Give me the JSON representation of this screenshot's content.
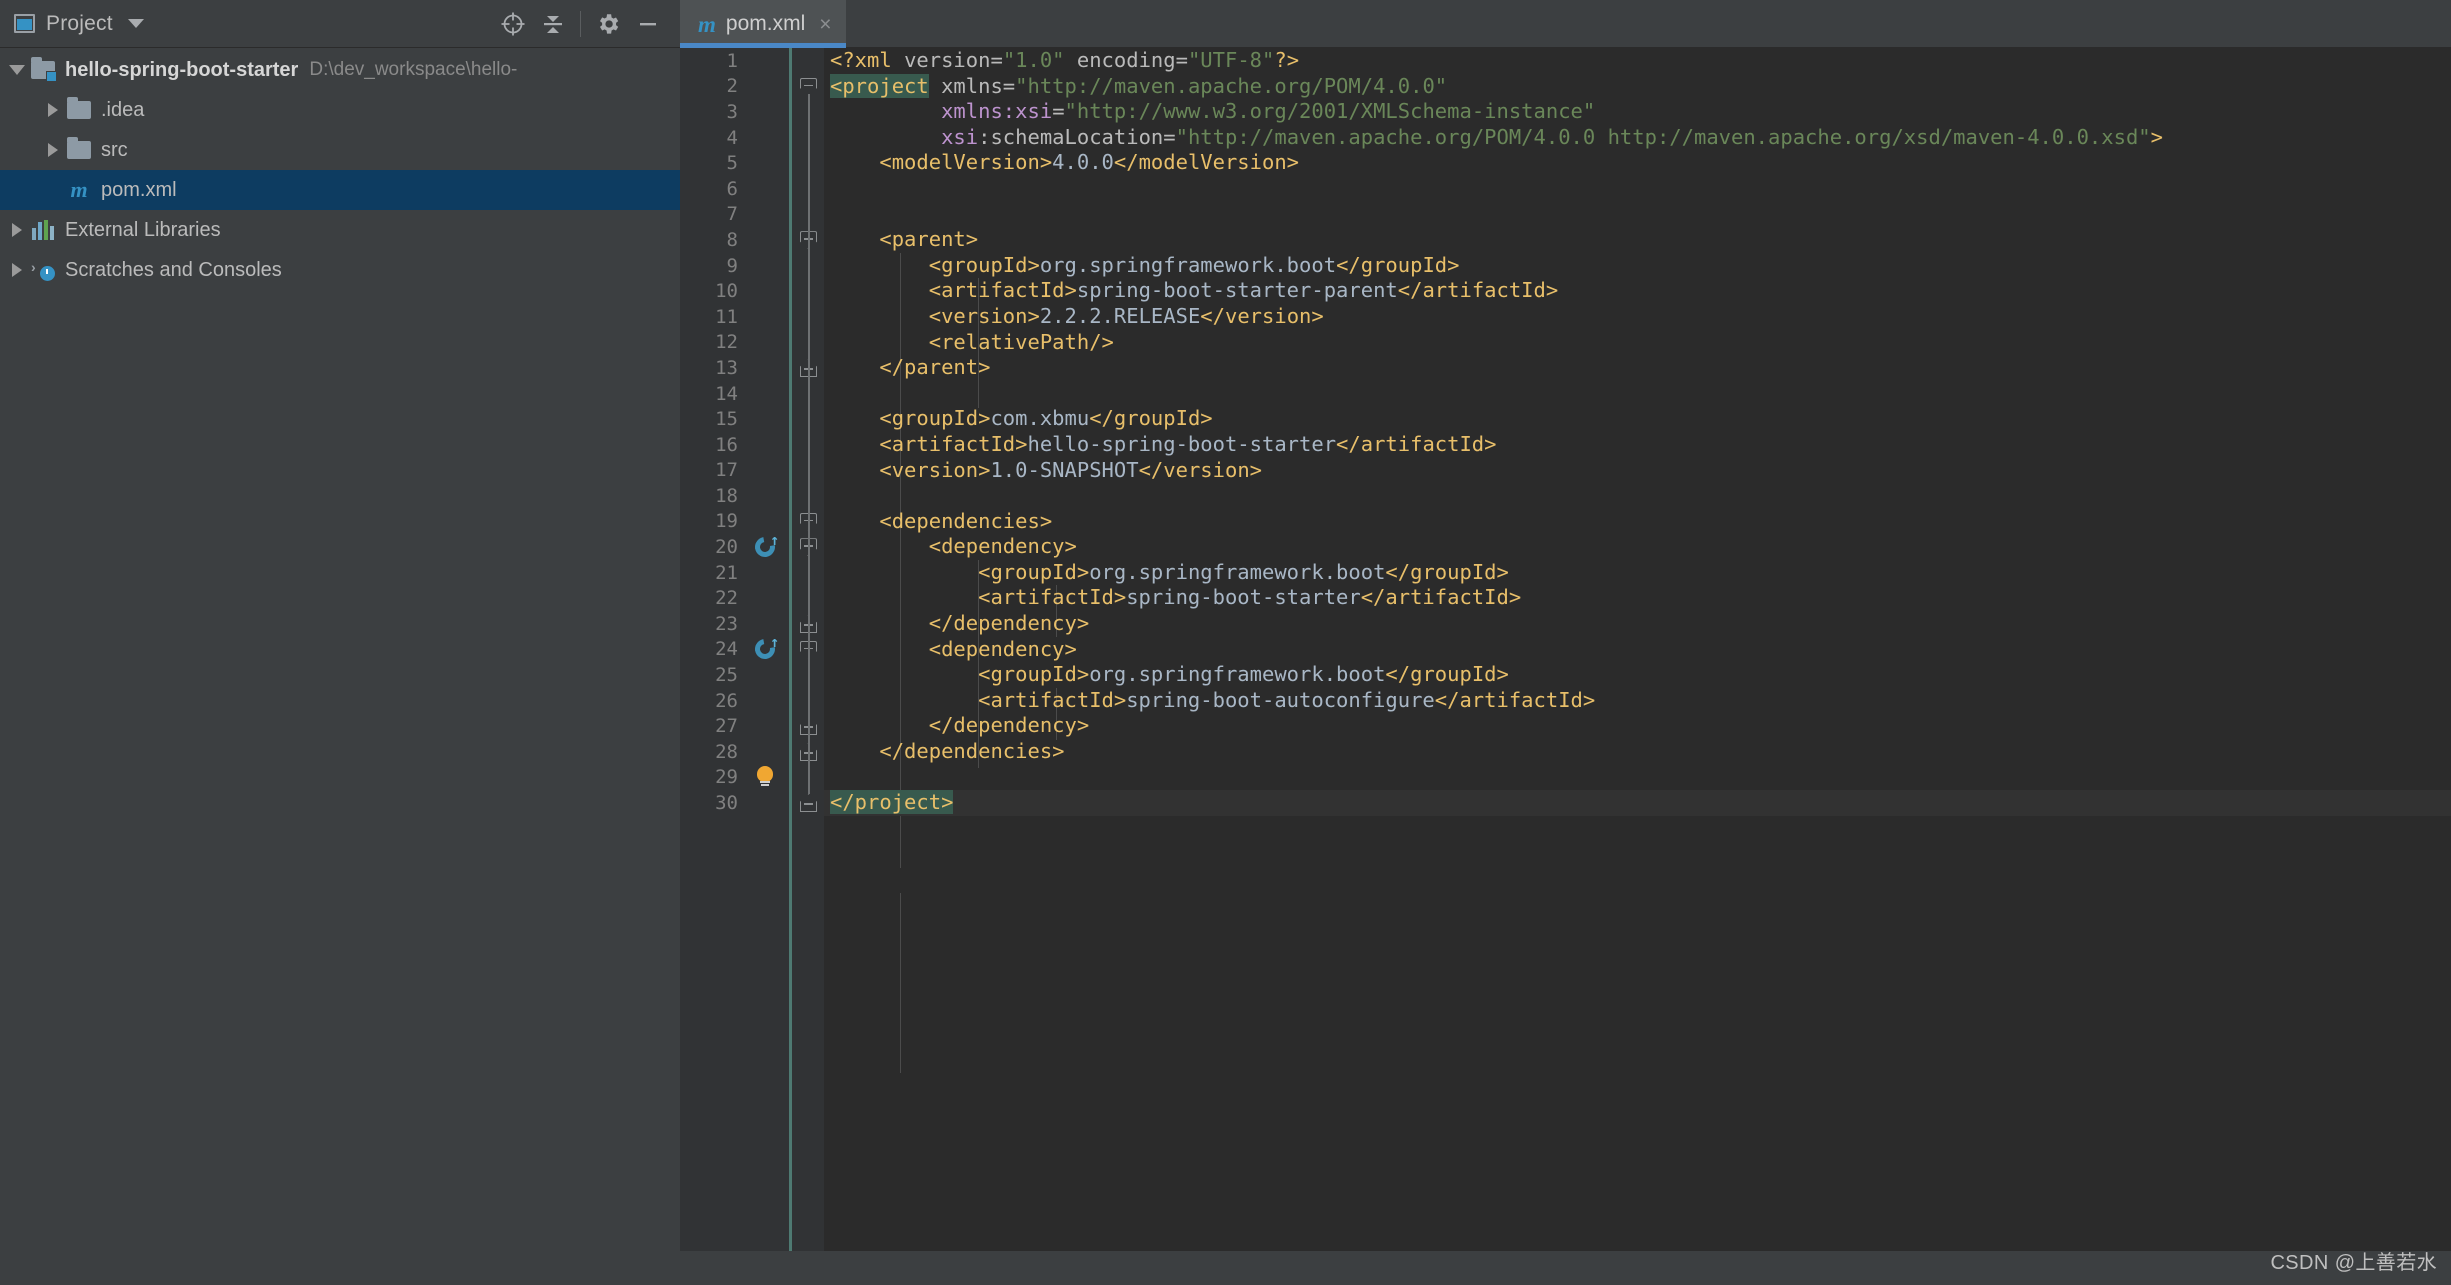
{
  "toolwindow": {
    "title": "Project",
    "icon": "project-panel-icon",
    "dropdown_icon": "chevron-down-icon",
    "actions": [
      {
        "name": "locate-icon",
        "label": "Select Opened File"
      },
      {
        "name": "collapse-all-icon",
        "label": "Collapse All"
      },
      {
        "name": "gear-icon",
        "label": "Settings"
      },
      {
        "name": "minimize-icon",
        "label": "Hide"
      }
    ]
  },
  "tabs": [
    {
      "label": "pom.xml",
      "icon": "maven-m-icon",
      "close": "×",
      "active": true
    }
  ],
  "tree": [
    {
      "name": "project-root",
      "label": "hello-spring-boot-starter",
      "path": "D:\\dev_workspace\\hello-",
      "indent": 0,
      "arrow": "open",
      "icon": "module-folder-icon",
      "bold": true,
      "selected": false
    },
    {
      "name": "tree-item-idea",
      "label": ".idea",
      "path": "",
      "indent": 1,
      "arrow": "closed",
      "icon": "folder-icon",
      "bold": false,
      "selected": false
    },
    {
      "name": "tree-item-src",
      "label": "src",
      "path": "",
      "indent": 1,
      "arrow": "closed",
      "icon": "folder-icon",
      "bold": false,
      "selected": false
    },
    {
      "name": "tree-item-pom",
      "label": "pom.xml",
      "path": "",
      "indent": 1,
      "arrow": "none",
      "icon": "maven-m-icon",
      "bold": false,
      "selected": true
    },
    {
      "name": "tree-item-external-libraries",
      "label": "External Libraries",
      "path": "",
      "indent": 0,
      "arrow": "closed",
      "icon": "libraries-icon",
      "bold": false,
      "selected": false
    },
    {
      "name": "tree-item-scratches",
      "label": "Scratches and Consoles",
      "path": "",
      "indent": 0,
      "arrow": "closed",
      "icon": "scratches-icon",
      "bold": false,
      "selected": false
    }
  ],
  "editor": {
    "language": "XML",
    "first_line": 1,
    "last_line": 30,
    "caret_line": 30,
    "gutter_icons": [
      {
        "line": 20,
        "name": "maven-dependency-icon"
      },
      {
        "line": 24,
        "name": "maven-dependency-icon"
      },
      {
        "line": 29,
        "name": "intention-bulb-icon"
      }
    ],
    "fold_markers": [
      {
        "line": 2,
        "type": "open"
      },
      {
        "line": 8,
        "type": "open"
      },
      {
        "line": 13,
        "type": "close"
      },
      {
        "line": 19,
        "type": "open"
      },
      {
        "line": 20,
        "type": "open"
      },
      {
        "line": 23,
        "type": "close"
      },
      {
        "line": 24,
        "type": "open"
      },
      {
        "line": 27,
        "type": "close"
      },
      {
        "line": 28,
        "type": "close"
      },
      {
        "line": 30,
        "type": "close"
      }
    ],
    "lines": [
      {
        "n": 1,
        "indent": 0,
        "html": "<span class=\"pi\">&lt;?xml </span><span class=\"at\">version=</span><span class=\"st\">\"1.0\"</span><span class=\"at\"> encoding=</span><span class=\"st\">\"UTF-8\"</span><span class=\"pi\">?&gt;</span>"
      },
      {
        "n": 2,
        "indent": 0,
        "html": "<span class=\"tg hl\">&lt;project</span><span class=\"at\"> xmlns=</span><span class=\"st\">\"http://maven.apache.org/POM/4.0.0\"</span>"
      },
      {
        "n": 3,
        "indent": 0,
        "html": "         <span class=\"ns\">xmlns:xsi</span><span class=\"at\">=</span><span class=\"st\">\"http://www.w3.org/2001/XMLSchema-instance\"</span>"
      },
      {
        "n": 4,
        "indent": 0,
        "html": "         <span class=\"ns\">xsi</span><span class=\"at\">:schemaLocation=</span><span class=\"st\">\"http://maven.apache.org/POM/4.0.0 http://maven.apache.org/xsd/maven-4.0.0.xsd\"</span><span class=\"tg\">&gt;</span>"
      },
      {
        "n": 5,
        "indent": 0,
        "html": "    <span class=\"tg\">&lt;modelVersion&gt;</span><span class=\"tx\">4.0.0</span><span class=\"tg\">&lt;/modelVersion&gt;</span>"
      },
      {
        "n": 6,
        "indent": 0,
        "html": ""
      },
      {
        "n": 7,
        "indent": 0,
        "html": ""
      },
      {
        "n": 8,
        "indent": 0,
        "html": "    <span class=\"tg\">&lt;parent&gt;</span>"
      },
      {
        "n": 9,
        "indent": 0,
        "html": "        <span class=\"tg\">&lt;groupId&gt;</span><span class=\"tx\">org.springframework.boot</span><span class=\"tg\">&lt;/groupId&gt;</span>"
      },
      {
        "n": 10,
        "indent": 0,
        "html": "        <span class=\"tg\">&lt;artifactId&gt;</span><span class=\"tx\">spring-boot-starter-parent</span><span class=\"tg\">&lt;/artifactId&gt;</span>"
      },
      {
        "n": 11,
        "indent": 0,
        "html": "        <span class=\"tg\">&lt;version&gt;</span><span class=\"tx\">2.2.2.RELEASE</span><span class=\"tg\">&lt;/version&gt;</span>"
      },
      {
        "n": 12,
        "indent": 0,
        "html": "        <span class=\"tg\">&lt;relativePath/&gt;</span>"
      },
      {
        "n": 13,
        "indent": 0,
        "html": "    <span class=\"tg\">&lt;/parent&gt;</span>"
      },
      {
        "n": 14,
        "indent": 0,
        "html": ""
      },
      {
        "n": 15,
        "indent": 0,
        "html": "    <span class=\"tg\">&lt;groupId&gt;</span><span class=\"tx\">com.xbmu</span><span class=\"tg\">&lt;/groupId&gt;</span>"
      },
      {
        "n": 16,
        "indent": 0,
        "html": "    <span class=\"tg\">&lt;artifactId&gt;</span><span class=\"tx\">hello-spring-boot-starter</span><span class=\"tg\">&lt;/artifactId&gt;</span>"
      },
      {
        "n": 17,
        "indent": 0,
        "html": "    <span class=\"tg\">&lt;version&gt;</span><span class=\"tx\">1.0-SNAPSHOT</span><span class=\"tg\">&lt;/version&gt;</span>"
      },
      {
        "n": 18,
        "indent": 0,
        "html": ""
      },
      {
        "n": 19,
        "indent": 0,
        "html": "    <span class=\"tg\">&lt;dependencies&gt;</span>"
      },
      {
        "n": 20,
        "indent": 0,
        "html": "        <span class=\"tg\">&lt;dependency&gt;</span>"
      },
      {
        "n": 21,
        "indent": 0,
        "html": "            <span class=\"tg\">&lt;groupId&gt;</span><span class=\"tx\">org.springframework.boot</span><span class=\"tg\">&lt;/groupId&gt;</span>"
      },
      {
        "n": 22,
        "indent": 0,
        "html": "            <span class=\"tg\">&lt;artifactId&gt;</span><span class=\"tx\">spring-boot-starter</span><span class=\"tg\">&lt;/artifactId&gt;</span>"
      },
      {
        "n": 23,
        "indent": 0,
        "html": "        <span class=\"tg\">&lt;/dependency&gt;</span>"
      },
      {
        "n": 24,
        "indent": 0,
        "html": "        <span class=\"tg\">&lt;dependency&gt;</span>"
      },
      {
        "n": 25,
        "indent": 0,
        "html": "            <span class=\"tg\">&lt;groupId&gt;</span><span class=\"tx\">org.springframework.boot</span><span class=\"tg\">&lt;/groupId&gt;</span>"
      },
      {
        "n": 26,
        "indent": 0,
        "html": "            <span class=\"tg\">&lt;artifactId&gt;</span><span class=\"tx\">spring-boot-autoconfigure</span><span class=\"tg\">&lt;/artifactId&gt;</span>"
      },
      {
        "n": 27,
        "indent": 0,
        "html": "        <span class=\"tg\">&lt;/dependency&gt;</span>"
      },
      {
        "n": 28,
        "indent": 0,
        "html": "    <span class=\"tg\">&lt;/dependencies&gt;</span>"
      },
      {
        "n": 29,
        "indent": 0,
        "html": ""
      },
      {
        "n": 30,
        "indent": 0,
        "html": "<span class=\"tg hl\">&lt;/project&gt;</span>"
      }
    ]
  },
  "watermark": "CSDN @上善若水",
  "colors": {
    "panel_bg": "#3C3F41",
    "editor_bg": "#2B2B2B",
    "gutter_bg": "#313335",
    "tab_active_bg": "#4E5254",
    "tab_underline": "#4A88C7",
    "tree_selection": "#0D3C61",
    "tag": "#E8BF6A",
    "string": "#6A8759",
    "text_content": "#A9B7C6",
    "namespace": "#BD93CE",
    "attribute": "#BABABA",
    "match_highlight": "#385A4E",
    "accent_blue": "#3592C4"
  }
}
